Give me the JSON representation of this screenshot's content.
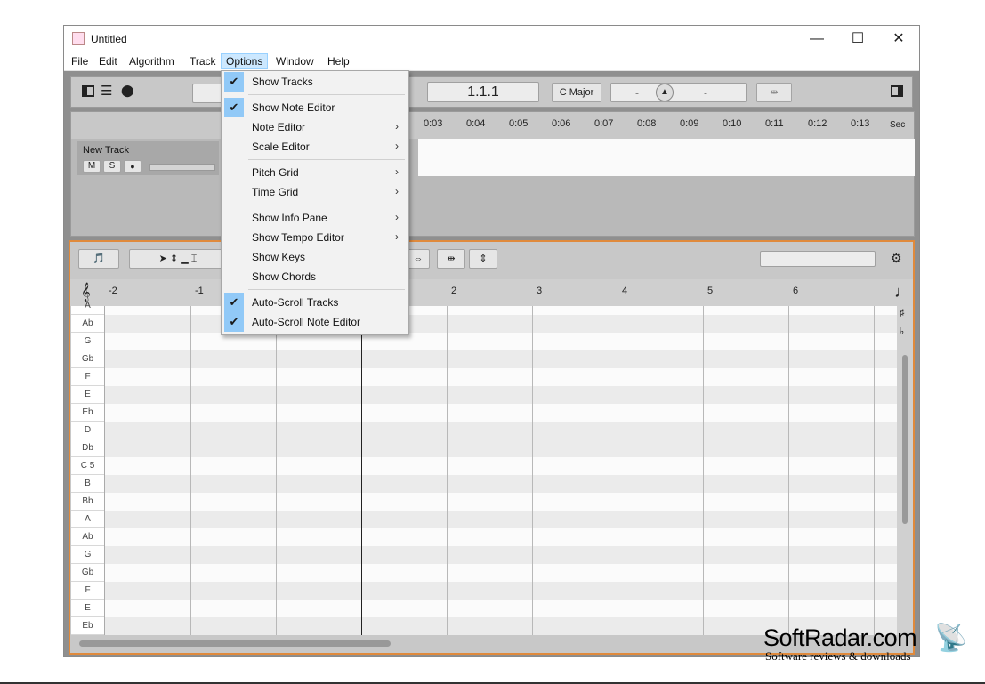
{
  "window": {
    "title": "Untitled",
    "minimize": "—",
    "maximize": "☐",
    "close": "✕"
  },
  "menubar": [
    "File",
    "Edit",
    "Algorithm",
    "Track",
    "Options",
    "Window",
    "Help"
  ],
  "transport": {
    "position": "1.1.1",
    "key": "C Major",
    "tempo_left": "-",
    "tempo_right": "-"
  },
  "tracks": {
    "ruler": [
      "0:03",
      "0:04",
      "0:05",
      "0:06",
      "0:07",
      "0:08",
      "0:09",
      "0:10",
      "0:11",
      "0:12",
      "0:13"
    ],
    "unit": "Sec",
    "track_name": "New Track",
    "mute": "M",
    "solo": "S"
  },
  "editor": {
    "ruler": [
      "-2",
      "-1",
      "2",
      "3",
      "4",
      "5",
      "6"
    ],
    "keys": [
      "Ab",
      "G",
      "Gb",
      "F",
      "E",
      "Eb",
      "D",
      "Db",
      "C 5",
      "B",
      "Bb",
      "A",
      "Ab",
      "G",
      "Gb",
      "F",
      "E",
      "Eb"
    ],
    "top_key": "A"
  },
  "options_menu": {
    "items": [
      {
        "label": "Show Tracks",
        "checked": true,
        "submenu": false
      },
      {
        "label": "Show Note Editor",
        "checked": true,
        "submenu": false
      },
      {
        "label": "Note Editor",
        "checked": false,
        "submenu": true
      },
      {
        "label": "Scale Editor",
        "checked": false,
        "submenu": true
      },
      {
        "label": "Pitch Grid",
        "checked": false,
        "submenu": true
      },
      {
        "label": "Time Grid",
        "checked": false,
        "submenu": true
      },
      {
        "label": "Show Info Pane",
        "checked": false,
        "submenu": true
      },
      {
        "label": "Show Tempo Editor",
        "checked": false,
        "submenu": true
      },
      {
        "label": "Show Keys",
        "checked": false,
        "submenu": false
      },
      {
        "label": "Show Chords",
        "checked": false,
        "submenu": false
      },
      {
        "label": "Auto-Scroll Tracks",
        "checked": true,
        "submenu": false
      },
      {
        "label": "Auto-Scroll Note Editor",
        "checked": true,
        "submenu": false
      }
    ]
  },
  "watermark": {
    "main": "SoftRadar.com",
    "sub": "Software reviews & downloads"
  },
  "colors": {
    "accent": "#e08a3c",
    "menu_highlight": "#cce8ff",
    "check_bg": "#91c9f7"
  }
}
